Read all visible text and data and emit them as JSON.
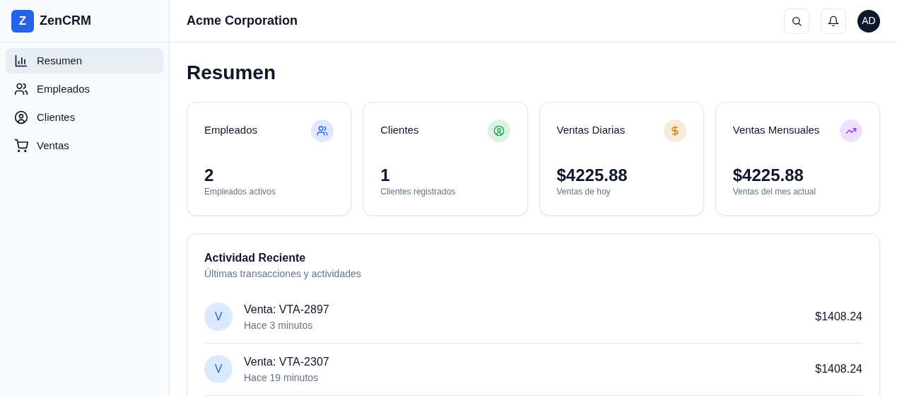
{
  "brand": {
    "logo_letter": "Z",
    "name": "ZenCRM"
  },
  "sidebar": {
    "items": [
      {
        "label": "Resumen",
        "kind": "chart",
        "selected": true
      },
      {
        "label": "Empleados",
        "kind": "users",
        "selected": false
      },
      {
        "label": "Clientes",
        "kind": "user-circle",
        "selected": false
      },
      {
        "label": "Ventas",
        "kind": "cart",
        "selected": false
      }
    ]
  },
  "header": {
    "title": "Acme Corporation",
    "avatar": "AD"
  },
  "page_title": "Resumen",
  "stats": [
    {
      "title": "Empleados",
      "kind": "users",
      "color": "#2563eb",
      "value": "2",
      "caption": "Empleados activos"
    },
    {
      "title": "Clientes",
      "kind": "user-circle",
      "color": "#16a34a",
      "value": "1",
      "caption": "Clientes registrados"
    },
    {
      "title": "Ventas Diarias",
      "kind": "dollar",
      "color": "#d97706",
      "value": "$4225.88",
      "caption": "Ventas de hoy"
    },
    {
      "title": "Ventas Mensuales",
      "kind": "trending",
      "color": "#9333ea",
      "value": "$4225.88",
      "caption": "Ventas del mes actual"
    }
  ],
  "activity": {
    "title": "Actividad Reciente",
    "subtitle": "Últimas transacciones y actividades",
    "items": [
      {
        "avatar": "V",
        "title": "Venta: VTA-2897",
        "time": "Hace 3 minutos",
        "amount": "$1408.24"
      },
      {
        "avatar": "V",
        "title": "Venta: VTA-2307",
        "time": "Hace 19 minutos",
        "amount": "$1408.24"
      }
    ]
  }
}
